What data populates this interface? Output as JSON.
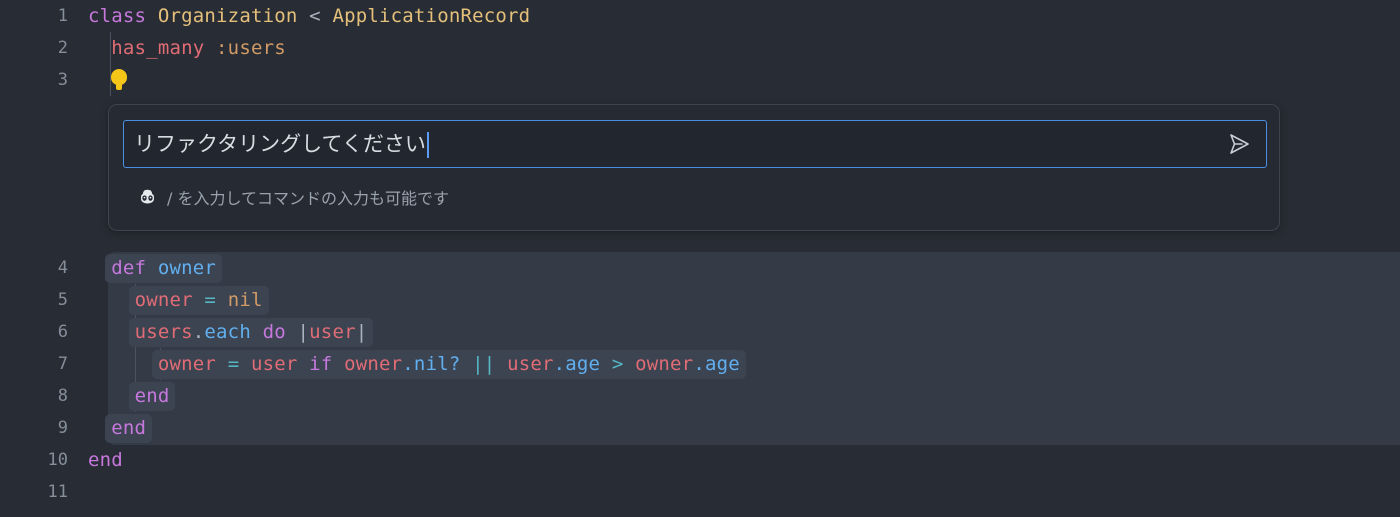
{
  "editor": {
    "theme_background": "#282c34",
    "gutter_line_number_color": "#868e9b",
    "suggestion_block_background": "#343a46"
  },
  "lines": [
    {
      "number": "1",
      "indent": 0,
      "kind": "code"
    },
    {
      "number": "2",
      "indent": 1,
      "kind": "code"
    },
    {
      "number": "3",
      "indent": 1,
      "kind": "lightbulb"
    },
    {
      "number": "4",
      "indent": 1,
      "kind": "code"
    },
    {
      "number": "5",
      "indent": 2,
      "kind": "code"
    },
    {
      "number": "6",
      "indent": 2,
      "kind": "code"
    },
    {
      "number": "7",
      "indent": 3,
      "kind": "code"
    },
    {
      "number": "8",
      "indent": 2,
      "kind": "code"
    },
    {
      "number": "9",
      "indent": 1,
      "kind": "code"
    },
    {
      "number": "10",
      "indent": 0,
      "kind": "code"
    },
    {
      "number": "11",
      "indent": 0,
      "kind": "empty"
    }
  ],
  "code": {
    "line1": {
      "kw_class": "class",
      "const_name": "Organization",
      "op_lt": "<",
      "const_parent": "ApplicationRecord"
    },
    "line2": {
      "method": "has_many",
      "symbol": ":users"
    },
    "line4": {
      "kw_def": "def",
      "fn_name": "owner"
    },
    "line5": {
      "var": "owner",
      "op_assign": "=",
      "nil": "nil"
    },
    "line6": {
      "receiver": "users",
      "dot": ".",
      "method": "each",
      "kw_do": "do",
      "pipe_open": "|",
      "block_var": "user",
      "pipe_close": "|"
    },
    "line7": {
      "var": "owner",
      "op_assign": "=",
      "value": "user",
      "kw_if": "if",
      "cond_recv": "owner",
      "cond_method": ".nil?",
      "op_or": "||",
      "left_recv": "user",
      "left_prop": ".age",
      "op_gt": ">",
      "right_recv": "owner",
      "right_prop": ".age"
    },
    "line8": {
      "end": "end"
    },
    "line9": {
      "end": "end"
    },
    "line10": {
      "end": "end"
    }
  },
  "chat": {
    "input_value": "リファクタリングしてください",
    "input_placeholder": "",
    "hint_text": "/ を入力してコマンドの入力も可能です",
    "copilot_icon_name": "copilot-icon",
    "send_icon_name": "send-icon",
    "focus_border_color": "#4a90e2",
    "panel_background": "#252a33"
  }
}
